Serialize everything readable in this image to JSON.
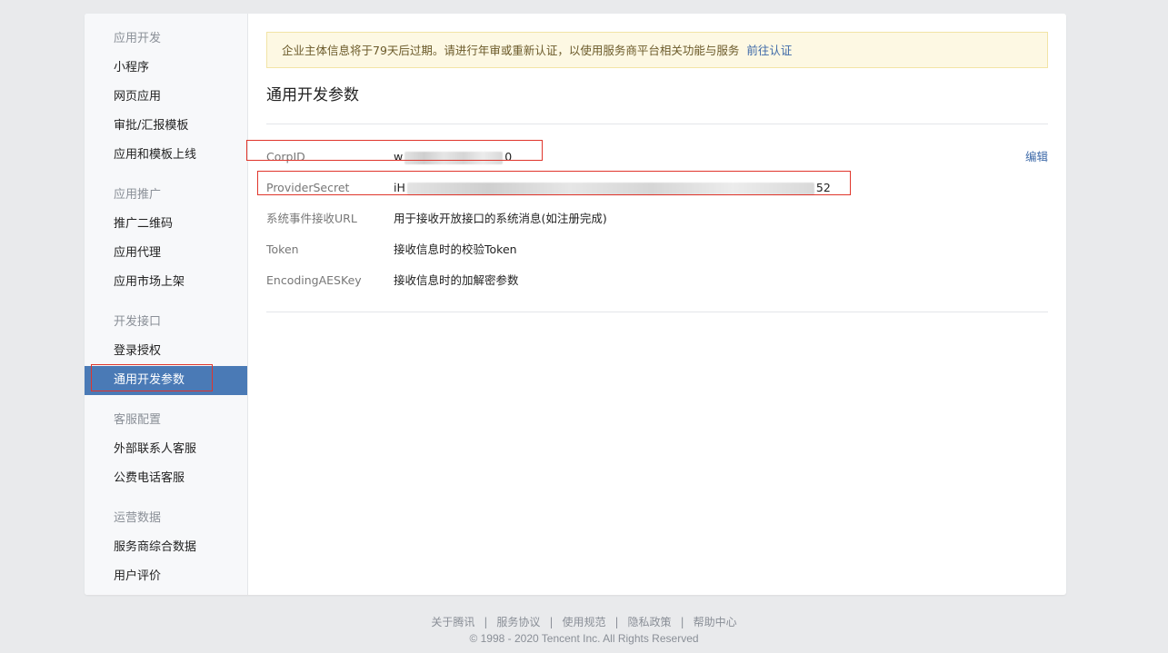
{
  "sidebar": {
    "groups": [
      {
        "title": "应用开发",
        "items": [
          "小程序",
          "网页应用",
          "审批/汇报模板",
          "应用和模板上线"
        ]
      },
      {
        "title": "应用推广",
        "items": [
          "推广二维码",
          "应用代理",
          "应用市场上架"
        ]
      },
      {
        "title": "开发接口",
        "items": [
          "登录授权",
          "通用开发参数"
        ]
      },
      {
        "title": "客服配置",
        "items": [
          "外部联系人客服",
          "公费电话客服"
        ]
      },
      {
        "title": "运营数据",
        "items": [
          "服务商综合数据",
          "用户评价"
        ]
      }
    ],
    "active_item": "通用开发参数"
  },
  "notice": {
    "text": "企业主体信息将于79天后过期。请进行年审或重新认证，以使用服务商平台相关功能与服务",
    "link": "前往认证"
  },
  "section": {
    "title": "通用开发参数",
    "edit_label": "编辑"
  },
  "params": [
    {
      "label": "CorpID",
      "value_prefix": "w",
      "value_suffix": "0",
      "masked": true
    },
    {
      "label": "ProviderSecret",
      "value_prefix": "iH",
      "value_suffix": "52",
      "masked": true
    },
    {
      "label": "系统事件接收URL",
      "value": "用于接收开放接口的系统消息(如注册完成)"
    },
    {
      "label": "Token",
      "value": "接收信息时的校验Token"
    },
    {
      "label": "EncodingAESKey",
      "value": "接收信息时的加解密参数"
    }
  ],
  "footer": {
    "links": [
      "关于腾讯",
      "服务协议",
      "使用规范",
      "隐私政策",
      "帮助中心"
    ],
    "separator": "|",
    "copyright": "© 1998 - 2020 Tencent Inc. All Rights Reserved"
  },
  "colors": {
    "active_nav": "#4a7ab6",
    "link": "#3d69a8",
    "highlight": "#e0352b",
    "notice_bg": "#fdf8e3"
  }
}
